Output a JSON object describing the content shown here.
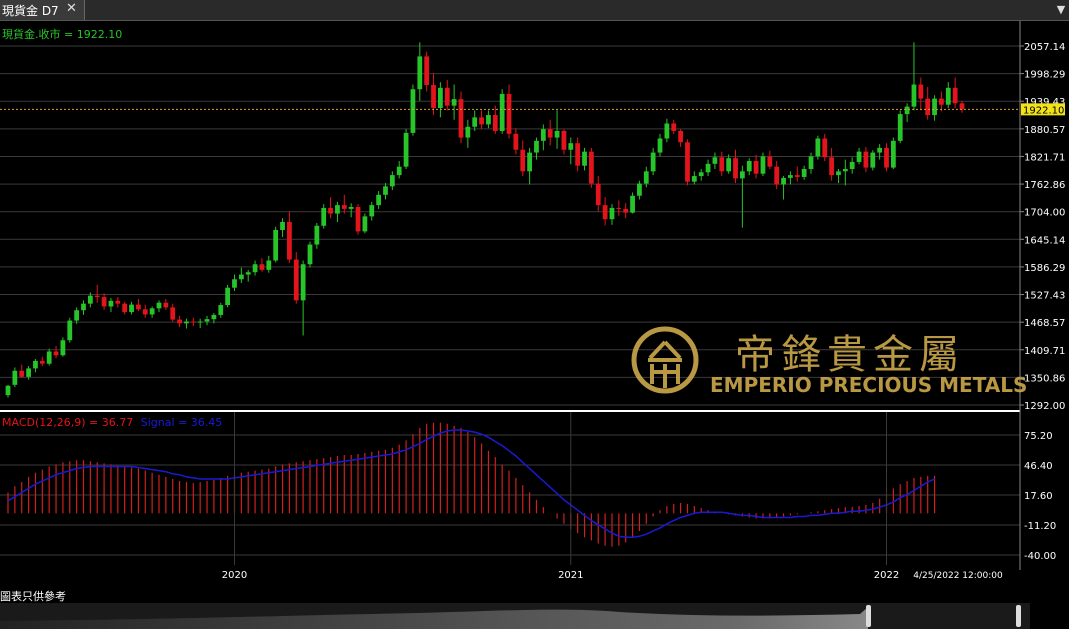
{
  "tab": {
    "title": "現貨金 D7",
    "close_label": "✕",
    "menu_label": "▼"
  },
  "price_label": "現貨金.收市 = 1922.10",
  "macd_label": {
    "name": "MACD(12,26,9) = 36.77",
    "signal": "Signal = 36.45"
  },
  "footer_note": "圖表只供參考",
  "watermark": {
    "chinese": "帝鋒貴金屬",
    "english": "EMPERIO PRECIOUS METALS"
  },
  "colors": {
    "up": "#27c42a",
    "down": "#e3141b",
    "macd_hist": "#d11f1f",
    "signal": "#1a1ad6",
    "last_line": "#e0a030",
    "grid": "#3a3a3a",
    "gold": "#c9a54a"
  },
  "chart_data": {
    "type": "candlestick",
    "price_axis": {
      "ticks": [
        2057.14,
        1998.29,
        1939.43,
        1880.57,
        1821.71,
        1762.86,
        1704.0,
        1645.14,
        1586.29,
        1527.43,
        1468.57,
        1409.71,
        1350.86,
        1292.0
      ],
      "last_value": 1922.1,
      "last_label": "1922.10"
    },
    "macd_axis": {
      "ticks": [
        75.2,
        46.4,
        17.6,
        -11.2,
        -40.0
      ]
    },
    "x_ticks": [
      "2020",
      "2021",
      "2022"
    ],
    "last_date_label": "4/25/2022 12:00:00",
    "candles": [
      [
        1313,
        1335,
        1308,
        1333
      ],
      [
        1335,
        1372,
        1330,
        1365
      ],
      [
        1365,
        1378,
        1350,
        1352
      ],
      [
        1352,
        1375,
        1346,
        1370
      ],
      [
        1370,
        1390,
        1362,
        1386
      ],
      [
        1386,
        1395,
        1375,
        1380
      ],
      [
        1380,
        1412,
        1376,
        1406
      ],
      [
        1406,
        1418,
        1392,
        1398
      ],
      [
        1398,
        1436,
        1395,
        1430
      ],
      [
        1430,
        1478,
        1425,
        1472
      ],
      [
        1472,
        1500,
        1465,
        1494
      ],
      [
        1494,
        1515,
        1484,
        1508
      ],
      [
        1508,
        1532,
        1500,
        1525
      ],
      [
        1525,
        1548,
        1510,
        1522
      ],
      [
        1522,
        1530,
        1495,
        1502
      ],
      [
        1502,
        1520,
        1490,
        1514
      ],
      [
        1514,
        1522,
        1500,
        1508
      ],
      [
        1508,
        1512,
        1485,
        1490
      ],
      [
        1490,
        1512,
        1485,
        1506
      ],
      [
        1506,
        1518,
        1492,
        1496
      ],
      [
        1496,
        1506,
        1478,
        1485
      ],
      [
        1485,
        1502,
        1478,
        1498
      ],
      [
        1498,
        1515,
        1490,
        1510
      ],
      [
        1510,
        1518,
        1495,
        1500
      ],
      [
        1500,
        1508,
        1470,
        1474
      ],
      [
        1474,
        1482,
        1458,
        1466
      ],
      [
        1466,
        1476,
        1455,
        1470
      ],
      [
        1470,
        1478,
        1460,
        1468
      ],
      [
        1468,
        1476,
        1456,
        1470
      ],
      [
        1470,
        1482,
        1462,
        1475
      ],
      [
        1475,
        1488,
        1466,
        1484
      ],
      [
        1484,
        1510,
        1478,
        1505
      ],
      [
        1505,
        1548,
        1500,
        1542
      ],
      [
        1542,
        1570,
        1535,
        1560
      ],
      [
        1560,
        1585,
        1552,
        1570
      ],
      [
        1570,
        1580,
        1555,
        1575
      ],
      [
        1575,
        1600,
        1568,
        1592
      ],
      [
        1592,
        1605,
        1576,
        1580
      ],
      [
        1580,
        1610,
        1574,
        1600
      ],
      [
        1600,
        1672,
        1596,
        1665
      ],
      [
        1665,
        1690,
        1650,
        1682
      ],
      [
        1682,
        1705,
        1595,
        1602
      ],
      [
        1602,
        1618,
        1508,
        1515
      ],
      [
        1515,
        1600,
        1440,
        1592
      ],
      [
        1592,
        1640,
        1585,
        1634
      ],
      [
        1634,
        1680,
        1625,
        1674
      ],
      [
        1674,
        1720,
        1668,
        1712
      ],
      [
        1712,
        1735,
        1690,
        1700
      ],
      [
        1700,
        1725,
        1682,
        1718
      ],
      [
        1718,
        1740,
        1700,
        1710
      ],
      [
        1710,
        1722,
        1692,
        1714
      ],
      [
        1714,
        1720,
        1655,
        1662
      ],
      [
        1662,
        1700,
        1658,
        1694
      ],
      [
        1694,
        1725,
        1685,
        1718
      ],
      [
        1718,
        1748,
        1710,
        1740
      ],
      [
        1740,
        1765,
        1730,
        1758
      ],
      [
        1758,
        1790,
        1750,
        1782
      ],
      [
        1782,
        1812,
        1775,
        1800
      ],
      [
        1800,
        1880,
        1795,
        1872
      ],
      [
        1872,
        1975,
        1866,
        1965
      ],
      [
        1965,
        2065,
        1940,
        2035
      ],
      [
        2035,
        2045,
        1960,
        1974
      ],
      [
        1974,
        2000,
        1910,
        1925
      ],
      [
        1925,
        1980,
        1905,
        1968
      ],
      [
        1968,
        1985,
        1920,
        1930
      ],
      [
        1930,
        1975,
        1900,
        1944
      ],
      [
        1944,
        1960,
        1850,
        1862
      ],
      [
        1862,
        1900,
        1840,
        1885
      ],
      [
        1885,
        1920,
        1876,
        1905
      ],
      [
        1905,
        1920,
        1880,
        1890
      ],
      [
        1890,
        1920,
        1882,
        1910
      ],
      [
        1910,
        1930,
        1870,
        1876
      ],
      [
        1876,
        1965,
        1870,
        1955
      ],
      [
        1955,
        1975,
        1860,
        1870
      ],
      [
        1870,
        1882,
        1826,
        1836
      ],
      [
        1836,
        1856,
        1780,
        1790
      ],
      [
        1790,
        1840,
        1762,
        1830
      ],
      [
        1830,
        1862,
        1815,
        1855
      ],
      [
        1855,
        1890,
        1835,
        1880
      ],
      [
        1880,
        1900,
        1845,
        1862
      ],
      [
        1862,
        1920,
        1838,
        1876
      ],
      [
        1876,
        1880,
        1826,
        1836
      ],
      [
        1836,
        1862,
        1805,
        1850
      ],
      [
        1850,
        1862,
        1790,
        1802
      ],
      [
        1802,
        1840,
        1792,
        1832
      ],
      [
        1832,
        1840,
        1755,
        1764
      ],
      [
        1764,
        1780,
        1704,
        1718
      ],
      [
        1718,
        1735,
        1675,
        1688
      ],
      [
        1688,
        1720,
        1676,
        1712
      ],
      [
        1712,
        1728,
        1695,
        1710
      ],
      [
        1710,
        1722,
        1690,
        1702
      ],
      [
        1702,
        1745,
        1700,
        1738
      ],
      [
        1738,
        1770,
        1730,
        1764
      ],
      [
        1764,
        1800,
        1756,
        1790
      ],
      [
        1790,
        1840,
        1782,
        1830
      ],
      [
        1830,
        1870,
        1822,
        1860
      ],
      [
        1860,
        1902,
        1852,
        1892
      ],
      [
        1892,
        1900,
        1870,
        1876
      ],
      [
        1876,
        1880,
        1842,
        1852
      ],
      [
        1852,
        1858,
        1760,
        1768
      ],
      [
        1768,
        1790,
        1762,
        1780
      ],
      [
        1780,
        1795,
        1770,
        1788
      ],
      [
        1788,
        1815,
        1780,
        1806
      ],
      [
        1806,
        1830,
        1795,
        1820
      ],
      [
        1820,
        1832,
        1780,
        1790
      ],
      [
        1790,
        1826,
        1785,
        1818
      ],
      [
        1818,
        1836,
        1765,
        1775
      ],
      [
        1775,
        1802,
        1670,
        1790
      ],
      [
        1790,
        1818,
        1782,
        1812
      ],
      [
        1812,
        1825,
        1775,
        1785
      ],
      [
        1785,
        1830,
        1780,
        1822
      ],
      [
        1822,
        1834,
        1795,
        1800
      ],
      [
        1800,
        1812,
        1752,
        1762
      ],
      [
        1762,
        1780,
        1730,
        1776
      ],
      [
        1776,
        1790,
        1762,
        1782
      ],
      [
        1782,
        1800,
        1768,
        1778
      ],
      [
        1778,
        1802,
        1772,
        1795
      ],
      [
        1795,
        1830,
        1785,
        1822
      ],
      [
        1822,
        1866,
        1815,
        1860
      ],
      [
        1860,
        1870,
        1812,
        1820
      ],
      [
        1820,
        1840,
        1770,
        1782
      ],
      [
        1782,
        1795,
        1765,
        1790
      ],
      [
        1790,
        1815,
        1760,
        1795
      ],
      [
        1795,
        1820,
        1785,
        1810
      ],
      [
        1810,
        1840,
        1805,
        1832
      ],
      [
        1832,
        1842,
        1788,
        1798
      ],
      [
        1798,
        1835,
        1792,
        1830
      ],
      [
        1830,
        1848,
        1815,
        1840
      ],
      [
        1840,
        1850,
        1790,
        1798
      ],
      [
        1798,
        1862,
        1795,
        1855
      ],
      [
        1855,
        1920,
        1850,
        1912
      ],
      [
        1912,
        1935,
        1895,
        1928
      ],
      [
        1928,
        2065,
        1920,
        1975
      ],
      [
        1975,
        1990,
        1920,
        1945
      ],
      [
        1945,
        1970,
        1900,
        1910
      ],
      [
        1910,
        1952,
        1898,
        1945
      ],
      [
        1945,
        1960,
        1918,
        1932
      ],
      [
        1932,
        1980,
        1925,
        1968
      ],
      [
        1968,
        1990,
        1925,
        1935
      ],
      [
        1935,
        1940,
        1915,
        1922
      ]
    ],
    "macd": [
      20,
      26,
      30,
      35,
      39,
      42,
      45,
      47,
      49,
      50,
      51,
      51,
      50,
      49,
      48,
      47,
      46,
      45,
      44,
      43,
      41,
      39,
      37,
      35,
      33,
      31,
      30,
      29,
      30,
      31,
      32,
      34,
      36,
      38,
      39,
      40,
      41,
      42,
      43,
      45,
      47,
      48,
      49,
      50,
      51,
      52,
      53,
      54,
      55,
      56,
      56,
      57,
      58,
      59,
      60,
      61,
      63,
      66,
      70,
      76,
      82,
      86,
      87,
      87,
      86,
      84,
      82,
      78,
      73,
      67,
      60,
      54,
      47,
      41,
      34,
      27,
      20,
      13,
      6,
      0,
      -5,
      -10,
      -15,
      -19,
      -23,
      -26,
      -29,
      -31,
      -32,
      -31,
      -28,
      -23,
      -17,
      -10,
      -3,
      3,
      7,
      9,
      10,
      9,
      7,
      5,
      3,
      1,
      0,
      -1,
      -2,
      -3,
      -4,
      -5,
      -5,
      -5,
      -4,
      -3,
      -2,
      -1,
      0,
      1,
      2,
      3,
      4,
      5,
      6,
      6,
      7,
      8,
      10,
      14,
      18,
      24,
      28,
      31,
      34,
      35,
      36,
      36
    ],
    "signal": [
      12,
      16,
      20,
      24,
      28,
      31,
      34,
      37,
      39,
      41,
      43,
      44,
      45,
      45,
      45,
      45,
      45,
      45,
      45,
      44,
      43,
      42,
      41,
      40,
      38,
      37,
      35,
      34,
      33,
      33,
      33,
      33,
      33,
      34,
      35,
      36,
      37,
      38,
      39,
      40,
      41,
      42,
      43,
      44,
      45,
      46,
      47,
      48,
      49,
      50,
      51,
      52,
      53,
      54,
      55,
      56,
      57,
      59,
      61,
      64,
      67,
      71,
      74,
      77,
      79,
      80,
      80,
      79,
      78,
      76,
      73,
      69,
      65,
      60,
      55,
      49,
      43,
      37,
      31,
      25,
      19,
      13,
      8,
      3,
      -2,
      -7,
      -11,
      -15,
      -19,
      -22,
      -23,
      -23,
      -22,
      -20,
      -17,
      -14,
      -10,
      -7,
      -4,
      -2,
      0,
      1,
      1,
      1,
      1,
      0,
      -1,
      -2,
      -2,
      -3,
      -4,
      -4,
      -4,
      -4,
      -4,
      -3,
      -3,
      -2,
      -2,
      -1,
      0,
      0,
      1,
      2,
      2,
      3,
      4,
      6,
      8,
      11,
      15,
      18,
      22,
      26,
      30,
      33
    ]
  }
}
